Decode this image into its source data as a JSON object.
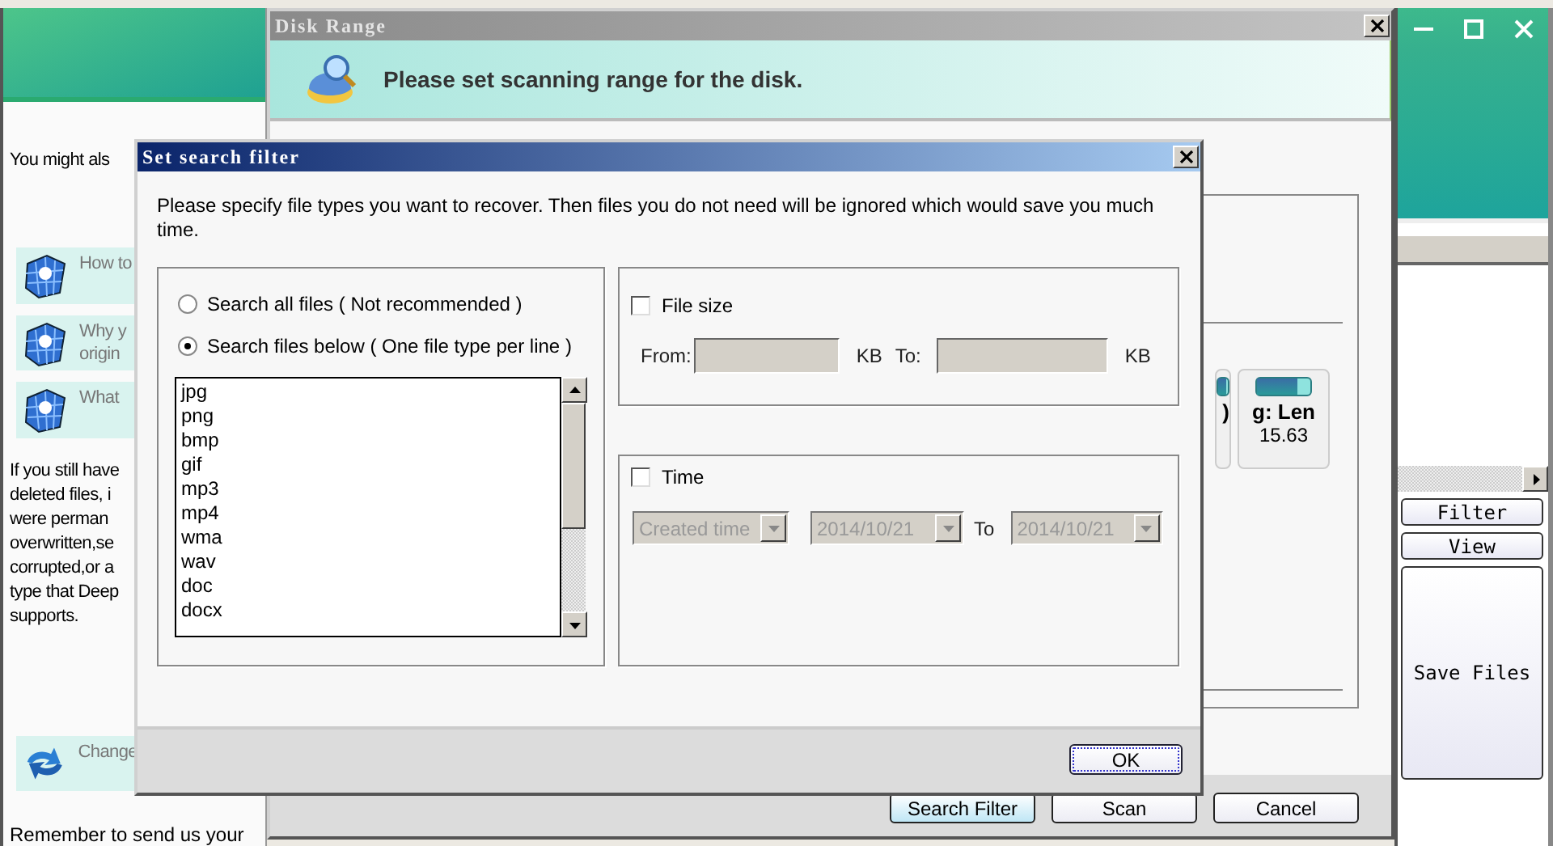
{
  "left_panel": {
    "intro": "You might als",
    "help_items": [
      {
        "kind": "question",
        "lines": [
          "How to"
        ]
      },
      {
        "kind": "question",
        "lines": [
          "Why y",
          "origin"
        ]
      },
      {
        "kind": "question",
        "lines": [
          "What"
        ]
      }
    ],
    "paragraph": [
      "If you still have",
      "deleted files, i",
      "were perman",
      "overwritten,se",
      "corrupted,or a",
      "type that Deep",
      "supports."
    ],
    "change_item": {
      "kind": "refresh",
      "lines": [
        "Change"
      ]
    },
    "footer": "Remember to send us your"
  },
  "right_panel": {
    "buttons": [
      "Filter",
      "View",
      "Save Files"
    ]
  },
  "disk_range": {
    "title": "Disk Range",
    "banner": "Please set scanning range for the disk.",
    "drives": [
      {
        "name": ")",
        "level": 0.9
      },
      {
        "name": "g: Len",
        "size": "15.63",
        "level": 0.75
      }
    ],
    "buttons": [
      {
        "label": "Search Filter",
        "selected": true
      },
      {
        "label": "Scan",
        "selected": false
      },
      {
        "label": "Cancel",
        "selected": false
      }
    ]
  },
  "filter_dialog": {
    "title": "Set search filter",
    "instructions": "Please specify file types you want to recover. Then files you do not need will be ignored which would save you much time.",
    "mode_options": [
      {
        "label": "Search all files ( Not recommended )",
        "selected": false
      },
      {
        "label": "Search files below ( One file type per line )",
        "selected": true
      }
    ],
    "file_types": [
      "jpg",
      "png",
      "bmp",
      "gif",
      "mp3",
      "mp4",
      "wma",
      "wav",
      "doc",
      "docx"
    ],
    "file_size": {
      "label": "File size",
      "checked": false,
      "from_label": "From:",
      "from_unit": "KB",
      "to_label": "To:",
      "to_unit": "KB"
    },
    "time": {
      "label": "Time",
      "checked": false,
      "type": "Created time",
      "from": "2014/10/21",
      "to_label": "To",
      "to": "2014/10/21"
    },
    "ok": "OK"
  }
}
